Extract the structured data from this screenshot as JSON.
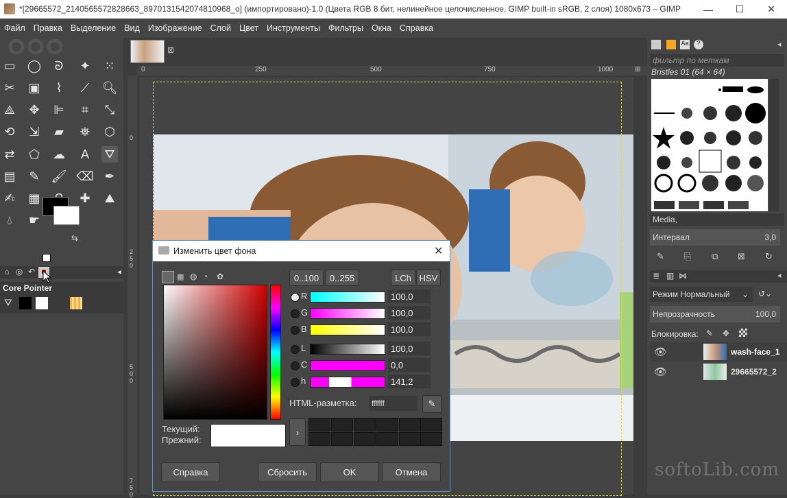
{
  "window": {
    "title": "*[29665572_2140565572828663_8970131542074810968_o] (импортировано)-1.0 (Цвета RGB 8 бит, нелинейное целочисленное, GIMP built-in sRGB, 2 слоя) 1080x673 – GIMP",
    "minimize": "—",
    "maximize": "☐",
    "close": "✕"
  },
  "menu": [
    "Файл",
    "Правка",
    "Выделение",
    "Вид",
    "Изображение",
    "Слой",
    "Цвет",
    "Инструменты",
    "Фильтры",
    "Окна",
    "Справка"
  ],
  "toolbox": {
    "tool_options_title": "Core Pointer",
    "fg_color": "#000000",
    "bg_color": "#ffffff"
  },
  "canvas": {
    "ruler_h": [
      "0",
      "250",
      "500",
      "750",
      "1000"
    ],
    "ruler_v": [
      "0",
      "250",
      "500",
      "750"
    ]
  },
  "dialog": {
    "title": "Изменить цвет фона",
    "range_buttons": [
      "0..100",
      "0..255"
    ],
    "model_buttons": [
      "LCh",
      "HSV"
    ],
    "channels": [
      {
        "label": "R",
        "value": "100,0",
        "selected": true
      },
      {
        "label": "G",
        "value": "100,0",
        "selected": false
      },
      {
        "label": "B",
        "value": "100,0",
        "selected": false
      },
      {
        "label": "L",
        "value": "100,0",
        "selected": false
      },
      {
        "label": "C",
        "value": "0,0",
        "selected": false
      },
      {
        "label": "h",
        "value": "141,2",
        "selected": false
      }
    ],
    "html_label": "HTML-разметка:",
    "html_value": "ffffff",
    "current_label": "Текущий:",
    "previous_label": "Прежний:",
    "buttons": {
      "help": "Справка",
      "reset": "Сбросить",
      "ok": "OK",
      "cancel": "Отмена"
    }
  },
  "right": {
    "filter_placeholder": "фильтр по меткам",
    "brush_name": "Bristles 01 (64 × 64)",
    "brush_preset": "Media,",
    "interval_label": "Интервал",
    "interval_value": "3,0",
    "mode_label": "Режим",
    "mode_value": "Нормальный",
    "opacity_label": "Непрозрачность",
    "opacity_value": "100,0",
    "lock_label": "Блокировка:",
    "layers": [
      {
        "name": "wash-face_1"
      },
      {
        "name": "29665572_2"
      }
    ]
  },
  "watermark": "softoLib.com"
}
